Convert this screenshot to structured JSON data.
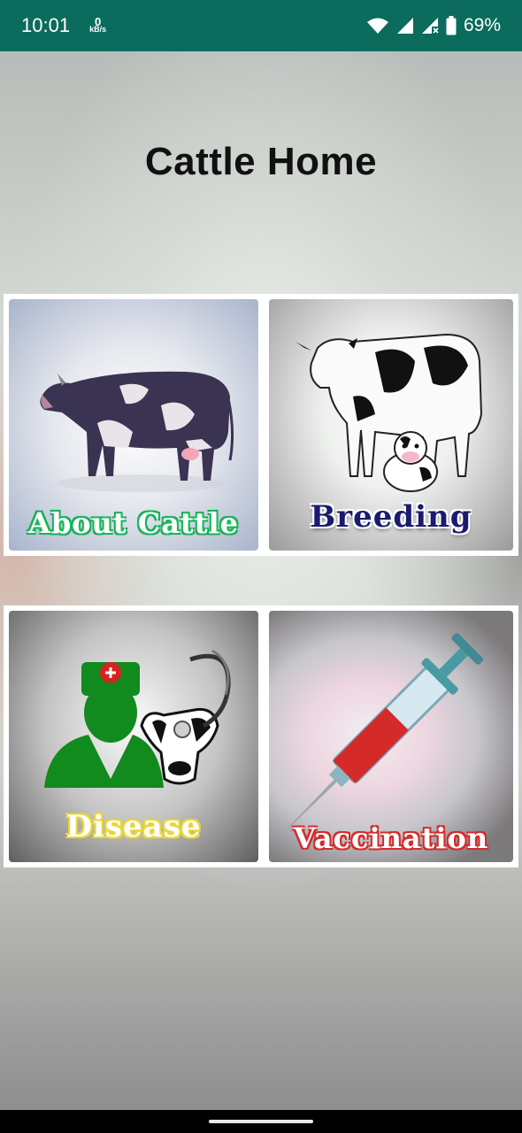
{
  "status_bar": {
    "time": "10:01",
    "net_speed_value": "0",
    "net_speed_unit": "kB/s",
    "battery": "69%",
    "icons": [
      "wifi-icon",
      "signal-icon",
      "signal-x-icon",
      "battery-icon"
    ]
  },
  "header": {
    "title": "Cattle Home"
  },
  "tiles": [
    {
      "label": "About Cattle",
      "icon": "cow-icon"
    },
    {
      "label": "Breeding",
      "icon": "cow-calf-icon"
    },
    {
      "label": "Disease",
      "icon": "vet-cow-icon"
    },
    {
      "label": "Vaccination",
      "icon": "syringe-icon"
    }
  ],
  "colors": {
    "status_bar": "#0b6b5c",
    "about_label_glow": "#27d26b",
    "breeding_label": "#1a1b6e",
    "disease_label_glow": "#e9d83a",
    "vaccination_label_glow": "#d62a2a"
  }
}
